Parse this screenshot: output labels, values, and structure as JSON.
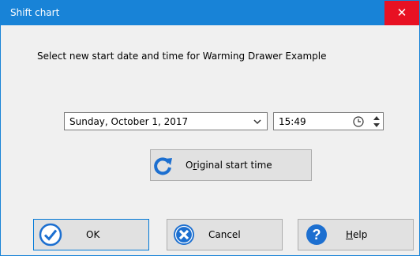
{
  "window": {
    "title": "Shift chart",
    "close_glyph": "✕"
  },
  "instruction": "Select new start date and time for Warming Drawer Example",
  "date_picker": {
    "value": "Sunday, October 1, 2017",
    "icon": "chevron-down-icon"
  },
  "time_picker": {
    "value": "15:49",
    "icons": [
      "clock-icon",
      "spin-up-down-icon"
    ]
  },
  "buttons": {
    "original_start_time": {
      "pre": "O",
      "accel": "r",
      "post": "iginal start time",
      "icon": "refresh-icon"
    },
    "ok": {
      "label": "OK",
      "icon": "check-icon"
    },
    "cancel": {
      "label": "Cancel",
      "icon": "cancel-icon"
    },
    "help": {
      "accel": "H",
      "post": "elp",
      "icon": "question-icon"
    }
  },
  "colors": {
    "titlebar": "#1883d7",
    "close": "#e81123",
    "icon_blue": "#1c6fd0",
    "dialog_bg": "#f0f0f0"
  }
}
